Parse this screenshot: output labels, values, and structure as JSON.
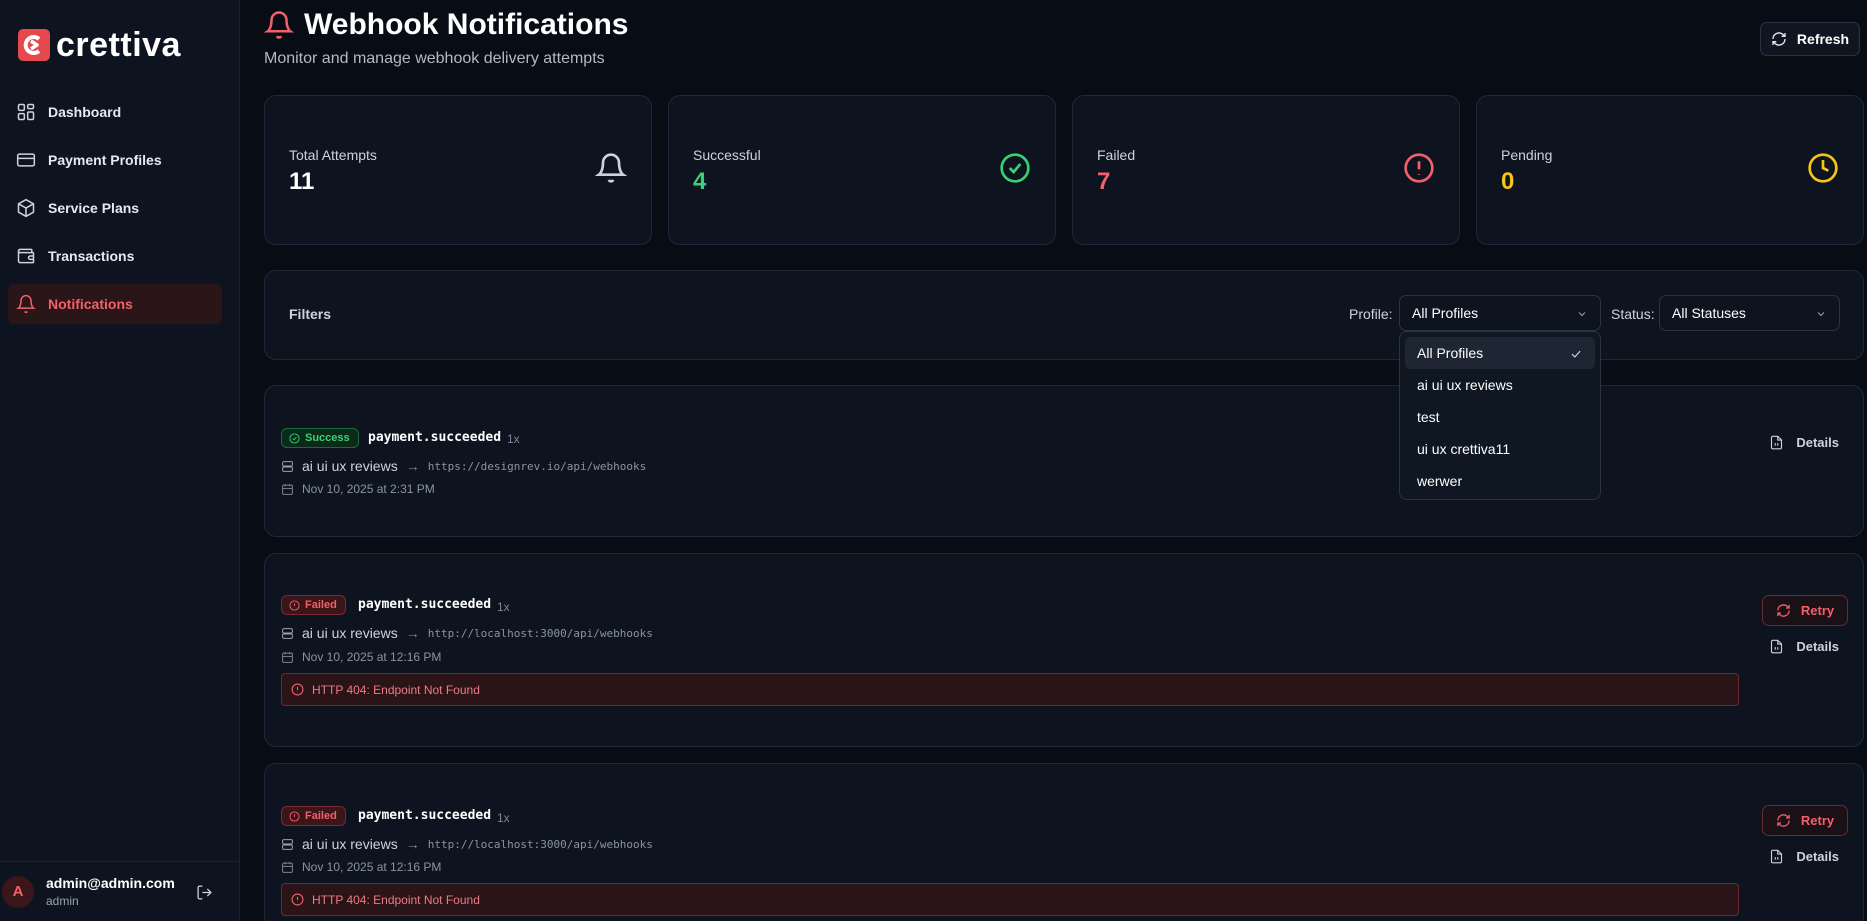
{
  "app": {
    "brand": "crettiva",
    "brand_color": "#e5484d"
  },
  "sidebar": {
    "items": [
      {
        "label": "Dashboard",
        "icon": "dashboard-icon",
        "active": false
      },
      {
        "label": "Payment Profiles",
        "icon": "credit-card-icon",
        "active": false
      },
      {
        "label": "Service Plans",
        "icon": "package-icon",
        "active": false
      },
      {
        "label": "Transactions",
        "icon": "wallet-icon",
        "active": false
      },
      {
        "label": "Notifications",
        "icon": "bell-icon",
        "active": true
      }
    ],
    "user": {
      "initial": "A",
      "email": "admin@admin.com",
      "role": "admin"
    }
  },
  "header": {
    "title": "Webhook Notifications",
    "subtitle": "Monitor and manage webhook delivery attempts",
    "refresh_label": "Refresh"
  },
  "stats": [
    {
      "label": "Total Attempts",
      "value": "11",
      "color": "#ffffff",
      "icon": "bell-icon"
    },
    {
      "label": "Successful",
      "value": "4",
      "color": "#3ccf73",
      "icon": "check-circle-icon"
    },
    {
      "label": "Failed",
      "value": "7",
      "color": "#f4606a",
      "icon": "alert-circle-icon"
    },
    {
      "label": "Pending",
      "value": "0",
      "color": "#f5c518",
      "icon": "clock-icon"
    }
  ],
  "filters": {
    "title": "Filters",
    "profile_label": "Profile:",
    "profile_value": "All Profiles",
    "status_label": "Status:",
    "status_value": "All Statuses",
    "profile_options": [
      "All Profiles",
      "ai ui ux reviews",
      "test",
      "ui ux crettiva11",
      "werwer"
    ]
  },
  "notifications": [
    {
      "status": "Success",
      "event": "payment.succeeded",
      "attempts": "1x",
      "profile": "ai ui ux reviews",
      "arrow": "→",
      "url": "https://designrev.io/api/webhooks",
      "date": "Nov 10, 2025 at 2:31 PM",
      "details_label": "Details"
    },
    {
      "status": "Failed",
      "event": "payment.succeeded",
      "attempts": "1x",
      "profile": "ai ui ux reviews",
      "arrow": "→",
      "url": "http://localhost:3000/api/webhooks",
      "date": "Nov 10, 2025 at 12:16 PM",
      "error": "HTTP 404: Endpoint Not Found",
      "retry_label": "Retry",
      "details_label": "Details"
    },
    {
      "status": "Failed",
      "event": "payment.succeeded",
      "attempts": "1x",
      "profile": "ai ui ux reviews",
      "arrow": "→",
      "url": "http://localhost:3000/api/webhooks",
      "date": "Nov 10, 2025 at 12:16 PM",
      "error": "HTTP 404: Endpoint Not Found",
      "retry_label": "Retry",
      "details_label": "Details"
    }
  ]
}
